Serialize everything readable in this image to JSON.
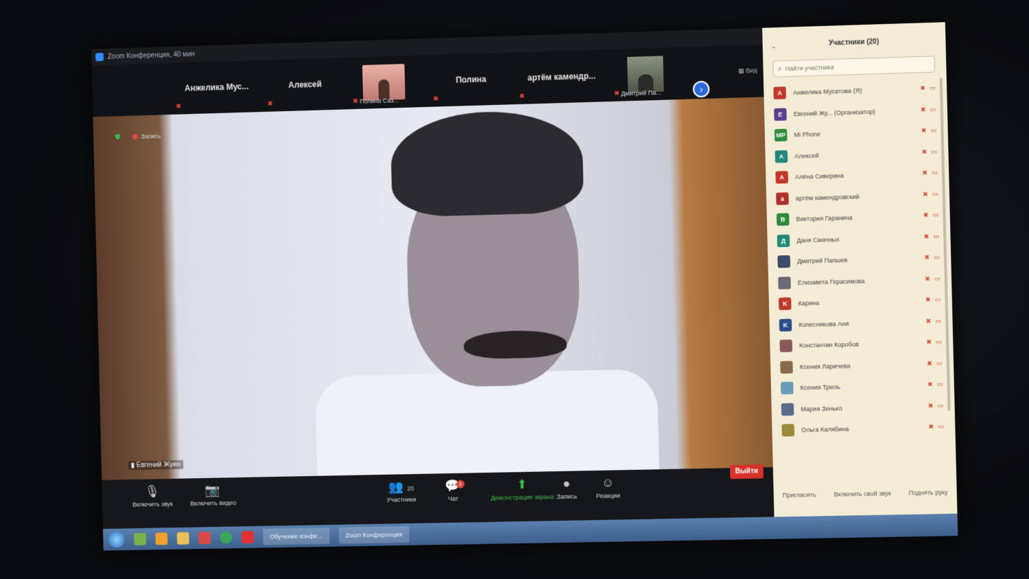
{
  "window": {
    "title": "Zoom Конференция, 40 мин"
  },
  "strip": {
    "tiles": [
      {
        "name": "Анжелика Мус..."
      },
      {
        "name": "Алексей"
      },
      {
        "caption": "Полина Саз..."
      },
      {
        "name": "Полина"
      },
      {
        "name": "артём камендр..."
      },
      {
        "caption": "Дмитрий Па..."
      }
    ],
    "view_label": "Вид"
  },
  "main": {
    "record_label": "Запись",
    "speaker_name": "Евгений Жуин"
  },
  "toolbar": {
    "mute_label": "Включить звук",
    "video_label": "Включить видео",
    "participants_count": "20",
    "participants_label": "Участники",
    "chat_badge": "1",
    "chat_label": "Чат",
    "share_label": "Демонстрация экрана",
    "record_label": "Запись",
    "reactions_label": "Реакции",
    "leave_label": "Выйти"
  },
  "panel": {
    "title": "Участники (20)",
    "search_placeholder": "Найти участника",
    "participants": [
      {
        "initial": "A",
        "color": "#c0392b",
        "name": "Анжелика Мусатова (Я)"
      },
      {
        "initial": "E",
        "color": "#5a3e8e",
        "name": "Евгений Жу... (Организатор)"
      },
      {
        "initial": "MP",
        "color": "#2e8b3d",
        "name": "Mi Phone"
      },
      {
        "initial": "A",
        "color": "#1f8a7a",
        "name": "Алексей"
      },
      {
        "initial": "A",
        "color": "#c0392b",
        "name": "Алёна Сиверина"
      },
      {
        "initial": "a",
        "color": "#b03030",
        "name": "артём камендровский"
      },
      {
        "initial": "B",
        "color": "#2e8b3d",
        "name": "Виктория Гаранина"
      },
      {
        "initial": "Д",
        "color": "#1f8a7a",
        "name": "Даня Смачных"
      },
      {
        "initial": "",
        "color": "#3a4a6a",
        "name": "Дмитрий Папшев"
      },
      {
        "initial": "",
        "color": "#6a6a7a",
        "name": "Елизавета Герасимова"
      },
      {
        "initial": "K",
        "color": "#c0392b",
        "name": "Карина"
      },
      {
        "initial": "K",
        "color": "#2a4e8a",
        "name": "Колесникова Аня"
      },
      {
        "initial": "",
        "color": "#8a5a5a",
        "name": "Константин Коробов"
      },
      {
        "initial": "",
        "color": "#8a6a4a",
        "name": "Ксения Ларичева"
      },
      {
        "initial": "",
        "color": "#6a9aba",
        "name": "Ксения Триль"
      },
      {
        "initial": "",
        "color": "#5a6a8a",
        "name": "Мария Зенько"
      },
      {
        "initial": "",
        "color": "#9a8a3a",
        "name": "Ольга Калябина"
      }
    ],
    "footer": {
      "invite": "Пригласить",
      "unmute_self": "Включить свой звук",
      "raise_hand": "Поднять руку"
    }
  },
  "taskbar": {
    "windows": [
      "Обучение конфе...",
      "Zoom Конференция"
    ]
  }
}
